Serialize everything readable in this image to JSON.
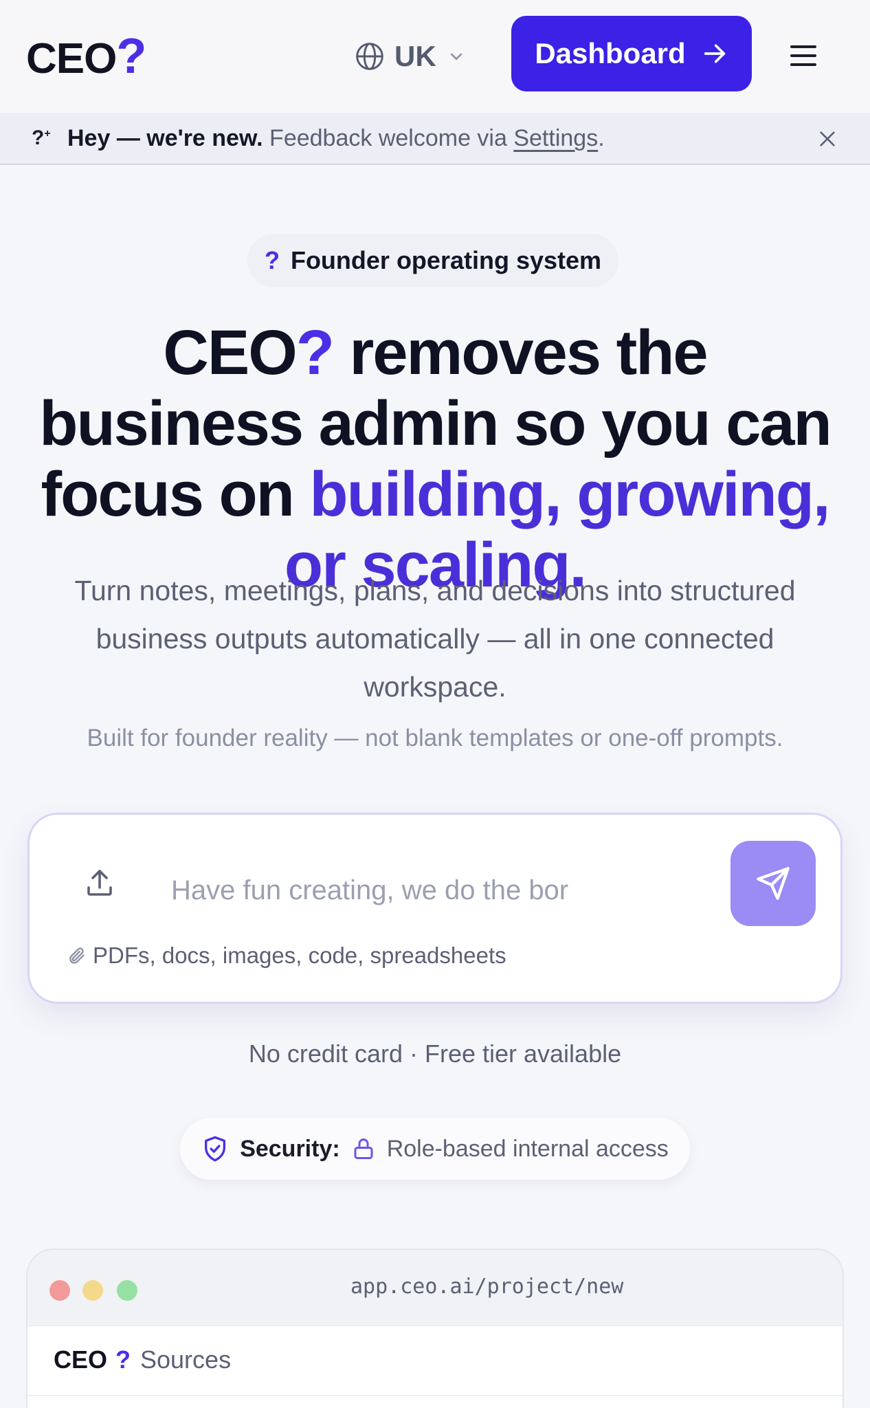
{
  "header": {
    "logo_text": "CEO",
    "logo_mark": "?",
    "language": "UK",
    "dashboard_label": "Dashboard"
  },
  "banner": {
    "icon": "question-spark-icon",
    "strong": "Hey — we're new.",
    "text": " Feedback welcome via ",
    "link": "Settings",
    "end": "."
  },
  "hero": {
    "badge_mark": "?",
    "badge_text": "Founder operating system",
    "headline_brand": "CEO",
    "headline_mark": "?",
    "headline_rest": " removes the business admin so you can focus on ",
    "headline_accent": "building, growing, or scaling.",
    "subtitle": "Turn notes, meetings, plans, and decisions into structured business outputs automatically — all in one connected workspace.",
    "subtitle2": "Built for founder reality — not blank templates or one-off prompts."
  },
  "composer": {
    "placeholder": "Have fun creating, we do the boring bits",
    "attach_text": "PDFs, docs, images, code, spreadsheets"
  },
  "no_credit": "No credit card · Free tier available",
  "security": {
    "label": "Security:",
    "value": "Role-based internal access"
  },
  "browser": {
    "url": "app.ceo.ai/project/new",
    "brand": "CEO",
    "brand_mark": "?",
    "tab": "Sources"
  },
  "colors": {
    "accent": "#4b2ee6",
    "button": "#3b22e6",
    "send": "#9a8bf5"
  }
}
